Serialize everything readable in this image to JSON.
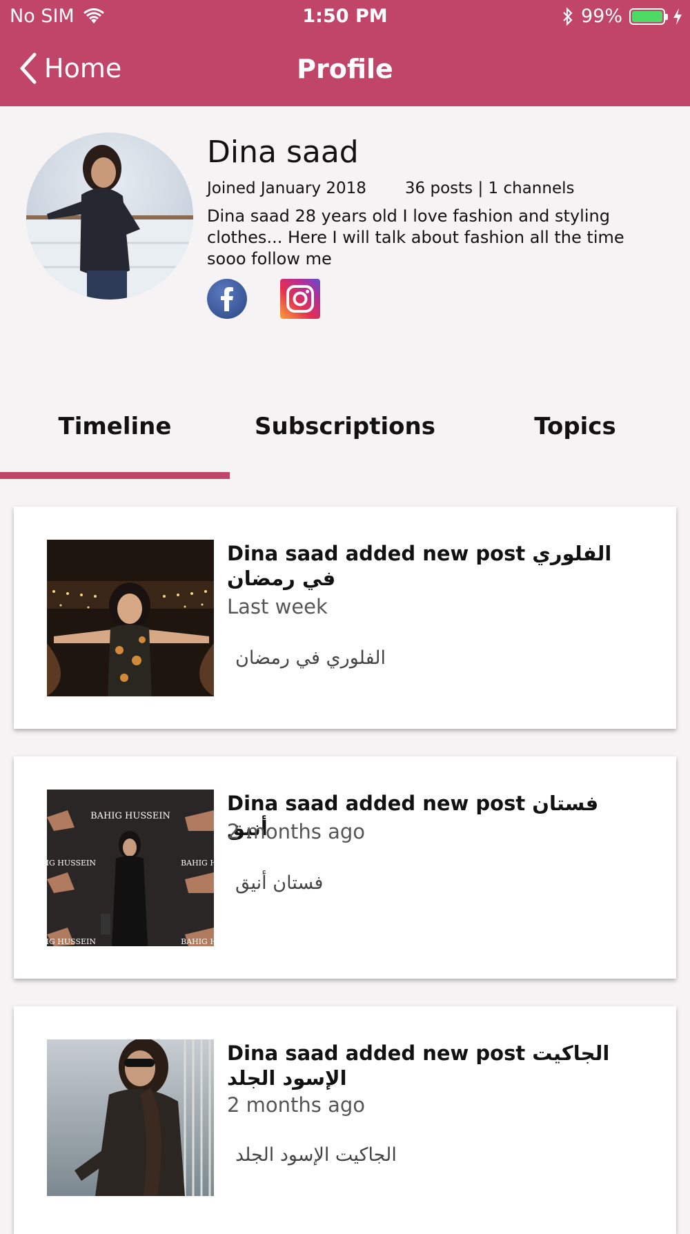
{
  "status_bar": {
    "carrier": "No SIM",
    "time": "1:50 PM",
    "battery": "99%",
    "battery_level": 0.99
  },
  "nav": {
    "back_label": "Home",
    "title": "Profile"
  },
  "profile": {
    "name": "Dina saad",
    "joined": "Joined January 2018",
    "stats": "36 posts | 1 channels",
    "bio": "Dina saad 28 years old I love fashion and styling clothes... Here I will talk about fashion all the time sooo follow me",
    "social": [
      "facebook-icon",
      "instagram-icon"
    ]
  },
  "tabs": [
    {
      "label": "Timeline",
      "active": true
    },
    {
      "label": "Subscriptions",
      "active": false
    },
    {
      "label": "Topics",
      "active": false
    }
  ],
  "colors": {
    "accent": "#c04568",
    "background": "#f5f3f4",
    "card": "#ffffff"
  },
  "timeline": [
    {
      "title": "Dina saad added new post الفلوري في رمضان",
      "time": "Last week",
      "tag": "الفلوري في رمضان"
    },
    {
      "title": "Dina saad added new post فستان أنيق",
      "time": "2 months ago",
      "tag": "فستان أنيق"
    },
    {
      "title": "Dina saad added new post الجاكيت الإسود الجلد",
      "time": "2 months ago",
      "tag": "الجاكيت الإسود الجلد"
    }
  ]
}
